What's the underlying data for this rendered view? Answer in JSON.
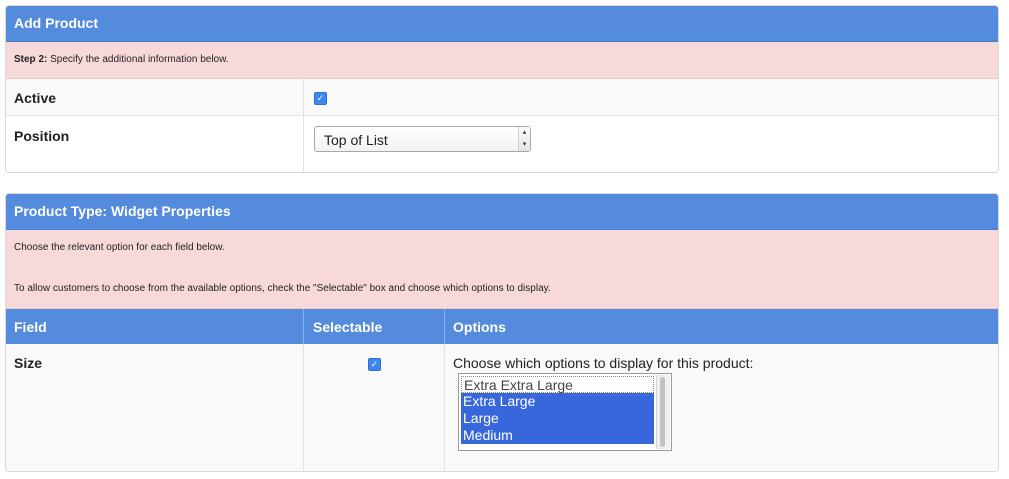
{
  "panel_add_product": {
    "title": "Add Product",
    "step_label": "Step 2:",
    "step_text": " Specify the additional information below.",
    "active_label": "Active",
    "active_checked": true,
    "position_label": "Position",
    "position_value": "Top of List"
  },
  "panel_product_type": {
    "title": "Product Type: Widget Properties",
    "info_line1": "Choose the relevant option for each field below.",
    "info_line2": "To allow customers to choose from the available options, check the \"Selectable\" box and choose which options to display.",
    "columns": [
      "Field",
      "Selectable",
      "Options"
    ],
    "rows": [
      {
        "field": "Size",
        "selectable": true,
        "options_prompt": "Choose which options to display for this product:",
        "options": [
          {
            "label": "Extra Extra Large",
            "selected": false
          },
          {
            "label": "Extra Large",
            "selected": true
          },
          {
            "label": "Large",
            "selected": true
          },
          {
            "label": "Medium",
            "selected": true
          }
        ]
      }
    ]
  },
  "colors": {
    "header": "#548bdc",
    "notice": "#f8d9d9",
    "selection": "#3767db",
    "checkbox": "#3f86f0"
  }
}
